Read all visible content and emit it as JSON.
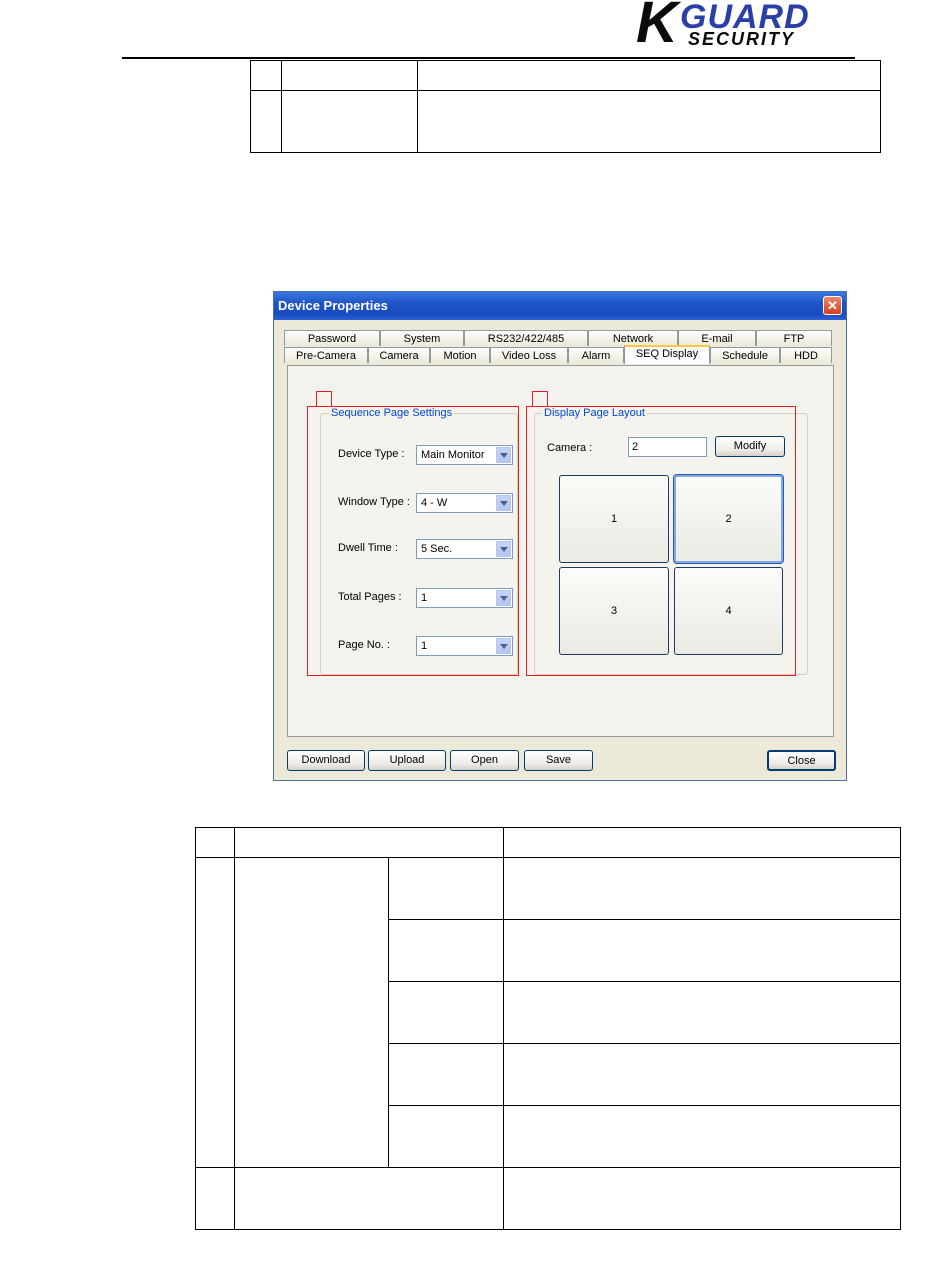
{
  "header": {
    "logo_k": "K",
    "logo_guard": "GUARD",
    "logo_security": "SECURITY"
  },
  "dialog": {
    "title": "Device Properties",
    "close_glyph": "✕",
    "tabs_row1": [
      "Password",
      "System",
      "RS232/422/485",
      "Network",
      "E-mail",
      "FTP"
    ],
    "tabs_row2": [
      "Pre-Camera",
      "Camera",
      "Motion",
      "Video Loss",
      "Alarm",
      "SEQ Display",
      "Schedule",
      "HDD"
    ],
    "active_tab": "SEQ Display",
    "sequence_group": {
      "title": "Sequence Page Settings",
      "device_type_label": "Device Type :",
      "device_type_value": "Main Monitor",
      "window_type_label": "Window Type :",
      "window_type_value": "4 - W",
      "dwell_time_label": "Dwell Time :",
      "dwell_time_value": "5 Sec.",
      "total_pages_label": "Total Pages :",
      "total_pages_value": "1",
      "page_no_label": "Page No. :",
      "page_no_value": "1"
    },
    "layout_group": {
      "title": "Display Page Layout",
      "camera_label": "Camera :",
      "camera_value": "2",
      "modify_label": "Modify",
      "cells": [
        "1",
        "2",
        "3",
        "4"
      ],
      "selected_cell": "2"
    },
    "buttons": {
      "download": "Download",
      "upload": "Upload",
      "open": "Open",
      "save": "Save",
      "close": "Close"
    }
  }
}
